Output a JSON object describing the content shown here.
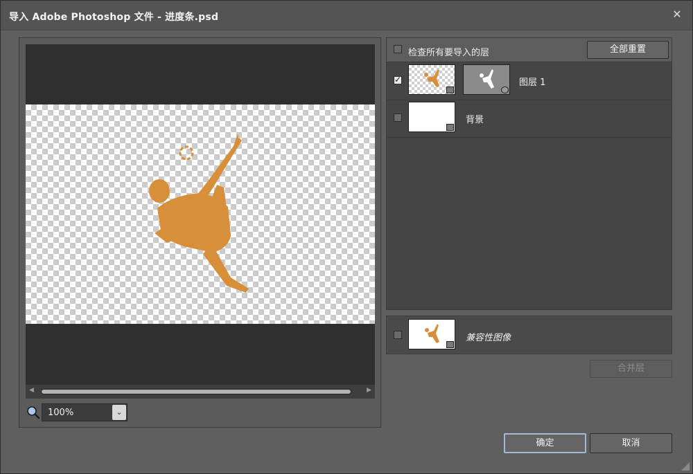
{
  "dialog": {
    "title": "导入 Adobe Photoshop 文件 - 进度条.psd",
    "close_glyph": "✕"
  },
  "preview": {
    "zoom_value": "100%",
    "scroll_left_glyph": "◀",
    "scroll_right_glyph": "▶",
    "dropdown_glyph": "⌄"
  },
  "layers": {
    "check_all_label": "检查所有要导入的层",
    "check_all_checked": false,
    "reset_all_label": "全部重置",
    "items": [
      {
        "label": "图层 1",
        "checked": true,
        "has_mask": true
      },
      {
        "label": "背景",
        "checked": false,
        "has_mask": false
      }
    ]
  },
  "composite": {
    "label": "兼容性图像",
    "checked": false
  },
  "buttons": {
    "merge_label": "合并层",
    "ok_label": "确定",
    "cancel_label": "取消"
  },
  "colors": {
    "figure": "#d88f3a",
    "dialog_bg": "#5f5f5f",
    "panel_bg": "#454545",
    "primary_border": "#9fbbd8"
  },
  "icons": [
    "close-icon",
    "checkbox-icon",
    "magnifier-icon",
    "chevron-down-icon",
    "layer-type-badge-icon",
    "resize-grip-icon"
  ]
}
